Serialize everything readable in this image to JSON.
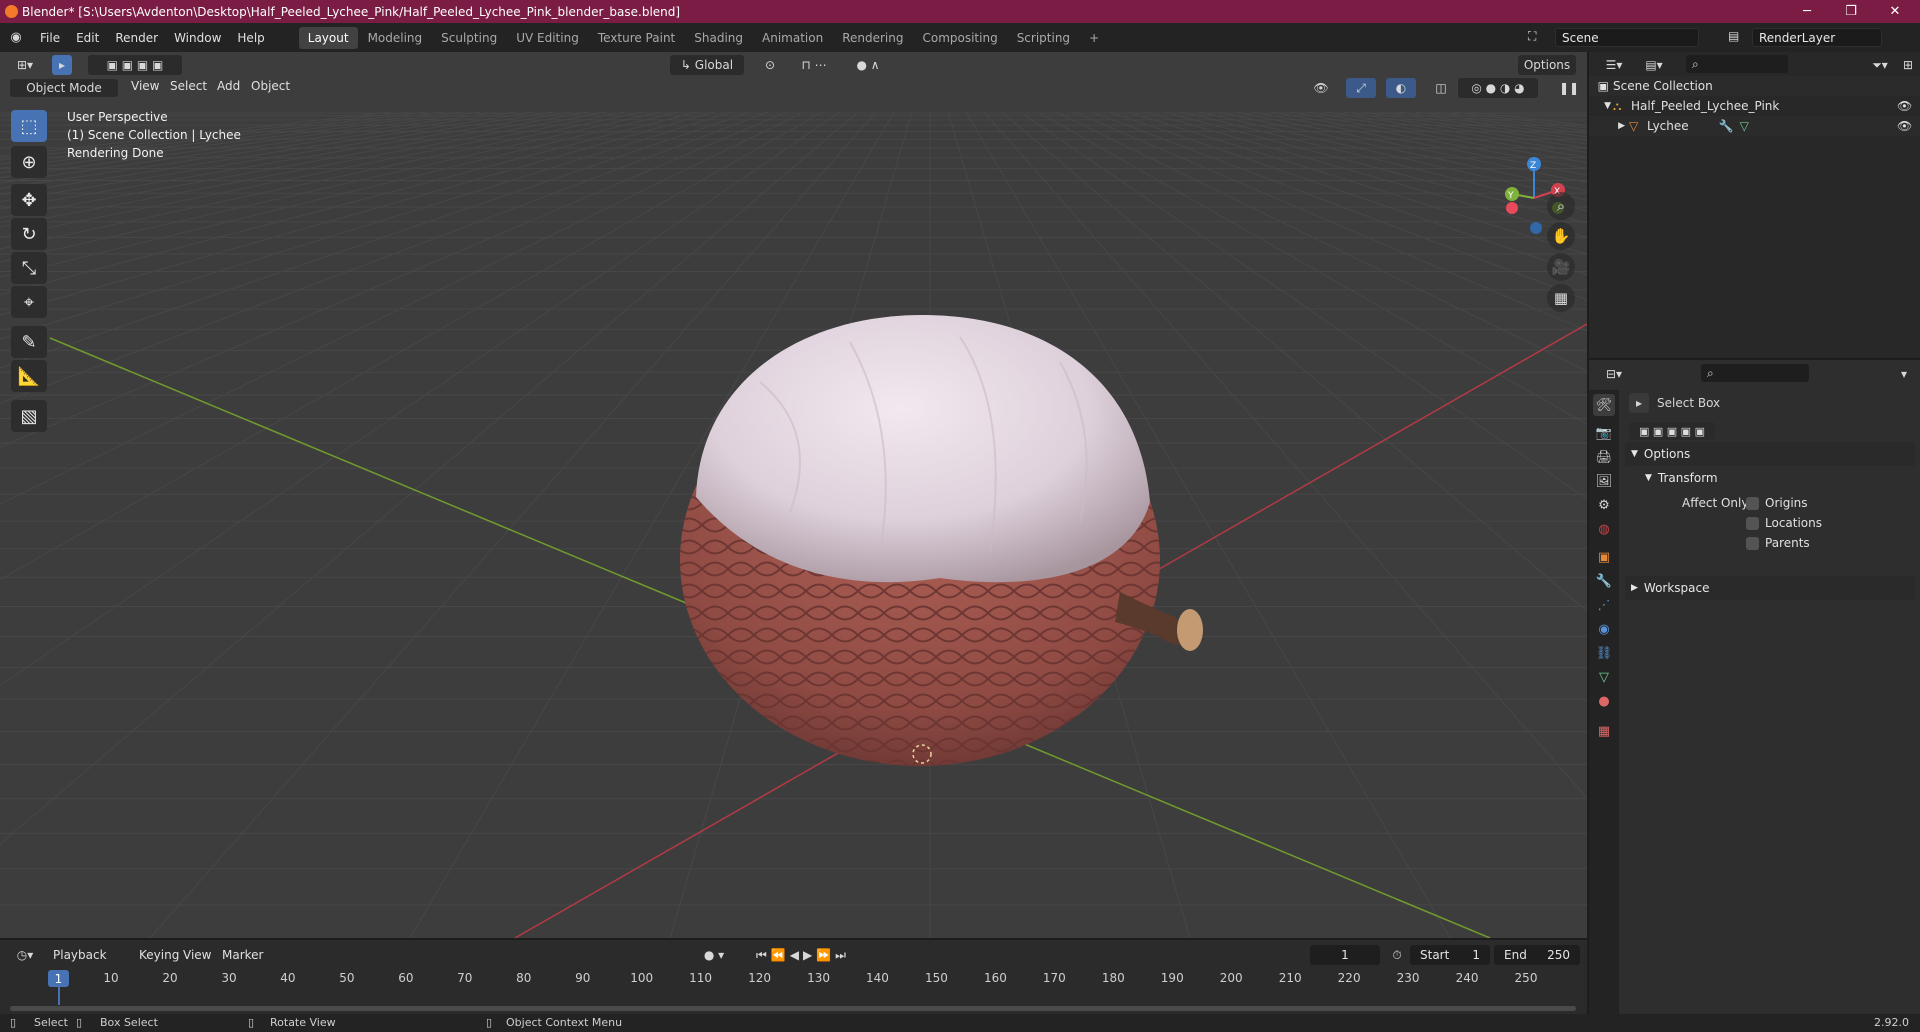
{
  "window": {
    "title": "Blender* [S:\\Users\\Avdenton\\Desktop\\Half_Peeled_Lychee_Pink/Half_Peeled_Lychee_Pink_blender_base.blend]",
    "minimize": "─",
    "maximize": "❐",
    "close": "✕"
  },
  "menubar": {
    "items": [
      "File",
      "Edit",
      "Render",
      "Window",
      "Help"
    ]
  },
  "workspaces": {
    "tabs": [
      "Layout",
      "Modeling",
      "Sculpting",
      "UV Editing",
      "Texture Paint",
      "Shading",
      "Animation",
      "Rendering",
      "Compositing",
      "Scripting"
    ],
    "active": "Layout",
    "add": "+"
  },
  "scene": {
    "scene_name": "Scene",
    "view_layer": "RenderLayer"
  },
  "viewport": {
    "mode": "Object Mode",
    "menus": [
      "View",
      "Select",
      "Add",
      "Object"
    ],
    "orientation": "Global",
    "options": "Options",
    "overlay_lines": [
      "User Perspective",
      "(1) Scene Collection | Lychee",
      "Rendering Done"
    ],
    "gizmo": {
      "z": "Z",
      "x": "X",
      "y": "Y"
    }
  },
  "timeline": {
    "menus": [
      "Playback",
      "Keying",
      "View",
      "Marker"
    ],
    "current_frame": "1",
    "start_label": "Start",
    "start_value": "1",
    "end_label": "End",
    "end_value": "250",
    "ruler": [
      "1",
      "10",
      "20",
      "30",
      "40",
      "50",
      "60",
      "70",
      "80",
      "90",
      "100",
      "110",
      "120",
      "130",
      "140",
      "150",
      "160",
      "170",
      "180",
      "190",
      "200",
      "210",
      "220",
      "230",
      "240",
      "250"
    ]
  },
  "statusbar": {
    "select": "Select",
    "box_select": "Box Select",
    "rotate_view": "Rotate View",
    "context_menu": "Object Context Menu",
    "version": "2.92.0"
  },
  "outliner": {
    "root": "Scene Collection",
    "collection": "Half_Peeled_Lychee_Pink",
    "object": "Lychee"
  },
  "properties": {
    "tool_name": "Select Box",
    "options_panel": "Options",
    "transform_panel": "Transform",
    "affect_only": "Affect Only",
    "checks": [
      "Origins",
      "Locations",
      "Parents"
    ],
    "workspace_panel": "Workspace"
  },
  "colors": {
    "accent": "#4772b3",
    "title_bar": "#7a1c44",
    "x_axis": "#d1424e",
    "y_axis": "#7fb23b",
    "z_axis": "#3b86d6"
  }
}
